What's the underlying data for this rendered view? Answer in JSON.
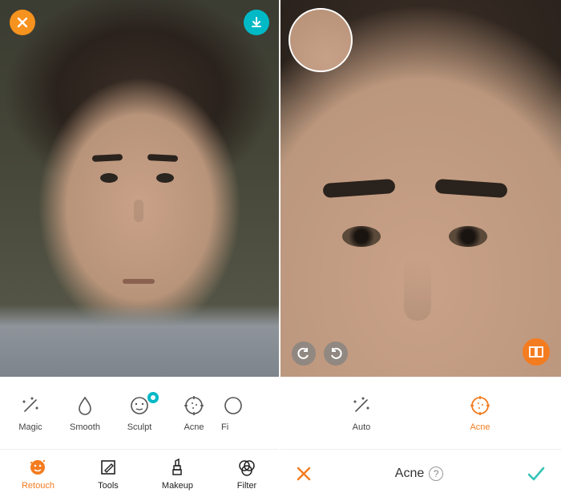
{
  "colors": {
    "accent": "#f47c20",
    "teal": "#00b9c6",
    "confirm": "#35c4b6"
  },
  "left": {
    "tools": {
      "magic": "Magic",
      "smooth": "Smooth",
      "sculpt": "Sculpt",
      "acne": "Acne",
      "firm_partial": "Fi"
    },
    "nav": {
      "retouch": "Retouch",
      "tools": "Tools",
      "makeup": "Makeup",
      "filter": "Filter"
    }
  },
  "right": {
    "tools": {
      "auto": "Auto",
      "acne": "Acne"
    },
    "title": "Acne"
  }
}
